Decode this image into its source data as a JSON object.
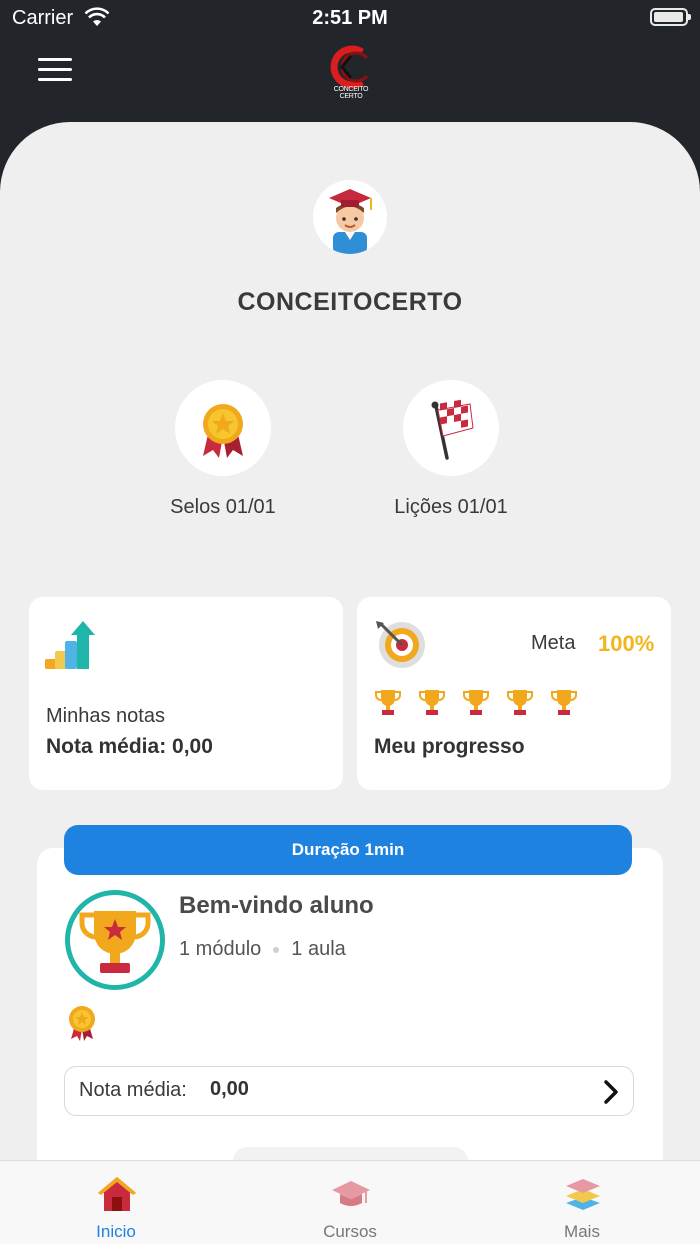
{
  "status_bar": {
    "carrier": "Carrier",
    "time": "2:51 PM"
  },
  "header": {
    "logo_text": "CONCEITO CERTO",
    "menu_icon": "hamburger-icon"
  },
  "profile": {
    "username": "CONCEITOCERTO",
    "avatar_icon": "student-avatar-icon"
  },
  "stats": [
    {
      "label": "Selos 01/01",
      "icon": "medal-icon"
    },
    {
      "label": "Lições 01/01",
      "icon": "checkered-flag-icon"
    }
  ],
  "grades_card": {
    "title": "Minhas notas",
    "average": "Nota média: 0,00",
    "icon": "bar-chart-up-icon"
  },
  "progress_card": {
    "meta_label": "Meta",
    "meta_value": "100%",
    "title": "Meu progresso",
    "trophy_count": 5,
    "icon": "target-icon"
  },
  "course": {
    "duration": "Duração 1min",
    "title": "Bem-vindo aluno",
    "modules": "1 módulo",
    "lessons": "1 aula",
    "note_label": "Nota média:",
    "note_value": "0,00"
  },
  "tabbar": {
    "active": "inicio",
    "tabs": [
      {
        "label": "Inicio",
        "icon": "home-icon"
      },
      {
        "label": "Cursos",
        "icon": "graduation-cap-icon"
      },
      {
        "label": "Mais",
        "icon": "layers-icon"
      }
    ]
  },
  "colors": {
    "accent": "#1e82e0",
    "header_bg": "#22252a",
    "meta": "#f2b51c",
    "teal": "#1fb5a8"
  }
}
